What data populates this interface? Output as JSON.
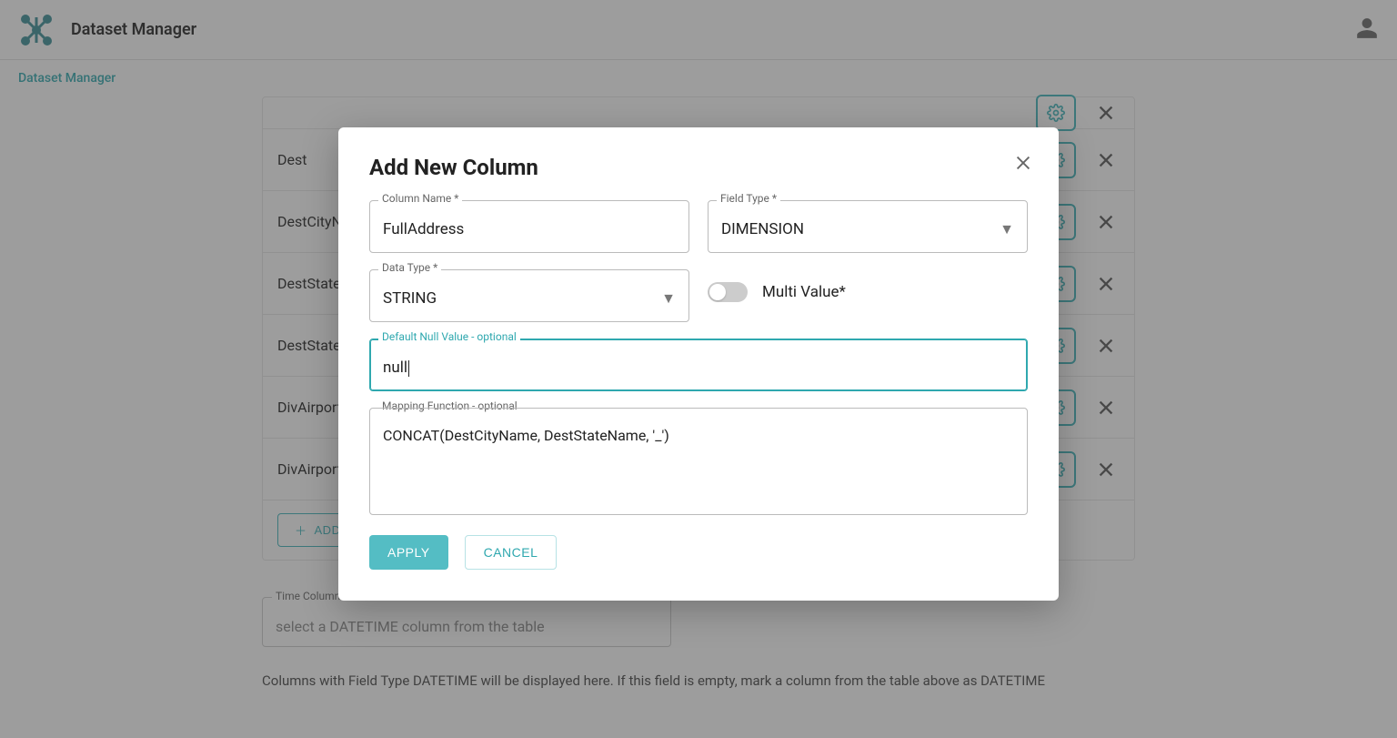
{
  "header": {
    "app_title": "Dataset Manager"
  },
  "breadcrumb": {
    "link": "Dataset Manager"
  },
  "table": {
    "rows": [
      {
        "name": "Dest"
      },
      {
        "name": "DestCityNa"
      },
      {
        "name": "DestState"
      },
      {
        "name": "DestStateN"
      },
      {
        "name": "DivAirportI"
      },
      {
        "name": "DivAirportS"
      }
    ],
    "add_button": "ADD"
  },
  "time_section": {
    "label": "Time Column",
    "placeholder": "select a DATETIME column from the table",
    "help": "Columns with Field Type DATETIME will be displayed here. If this field is empty, mark a column from the table above as DATETIME"
  },
  "modal": {
    "title": "Add New Column",
    "column_name": {
      "label": "Column Name *",
      "value": "FullAddress"
    },
    "field_type": {
      "label": "Field Type *",
      "value": "DIMENSION"
    },
    "data_type": {
      "label": "Data Type *",
      "value": "STRING"
    },
    "multi_value": {
      "label": "Multi Value*"
    },
    "default_null": {
      "label": "Default Null Value - optional",
      "value": "null"
    },
    "mapping_fn": {
      "label": "Mapping Function - optional",
      "value": "CONCAT(DestCityName, DestStateName, '_')"
    },
    "actions": {
      "apply": "APPLY",
      "cancel": "CANCEL"
    }
  }
}
